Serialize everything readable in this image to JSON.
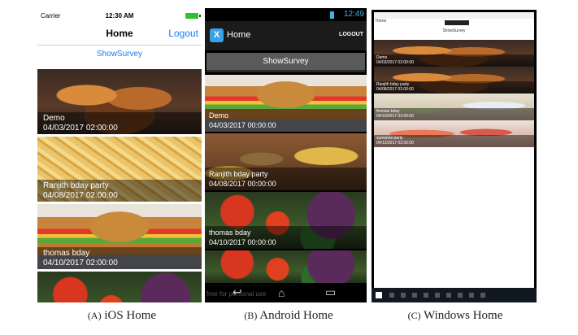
{
  "ios": {
    "carrier": "Carrier",
    "time": "12:30 AM",
    "title": "Home",
    "logout": "Logout",
    "show_survey": "ShowSurvey",
    "items": [
      {
        "name": "Demo",
        "date": "04/03/2017 02:00:00"
      },
      {
        "name": "Ranjith bday party",
        "date": "04/08/2017 02:00:00"
      },
      {
        "name": "thomas bday",
        "date": "04/10/2017 02:00:00"
      },
      {
        "name": "",
        "date": ""
      }
    ]
  },
  "android": {
    "clock": "12:49",
    "logo": "X",
    "title": "Home",
    "logout": "LOGOUT",
    "show_survey": "ShowSurvey",
    "items": [
      {
        "name": "Demo",
        "date": "04/03/2017 00:00:00"
      },
      {
        "name": "Ranjith bday party",
        "date": "04/08/2017 00:00:00"
      },
      {
        "name": "thomas bday",
        "date": "04/10/2017 00:00:00"
      },
      {
        "name": "",
        "date": ""
      }
    ],
    "watermark": "free for personal use",
    "nav_icons": [
      "back-icon",
      "home-icon",
      "recents-icon"
    ]
  },
  "windows": {
    "app_title": "Home",
    "show_survey": "ShowSurvey",
    "items": [
      {
        "name": "Demo",
        "date": "04/03/2017 02:00:00"
      },
      {
        "name": "Ranjith bday party",
        "date": "04/08/2017 02:00:00"
      },
      {
        "name": "thomas bday",
        "date": "04/10/2017 02:00:00"
      },
      {
        "name": "sumanss party",
        "date": "04/12/2017 02:00:00"
      }
    ]
  },
  "captions": {
    "a_prefix": "(A)",
    "a_text": "iOS Home",
    "b_prefix": "(B)",
    "b_text": "Android Home",
    "c_prefix": "(C)",
    "c_text": "Windows Home"
  },
  "colors": {
    "ios_tint": "#1a7bf0",
    "android_accent": "#3ab4e8",
    "ios_battery": "#2fc02f"
  }
}
